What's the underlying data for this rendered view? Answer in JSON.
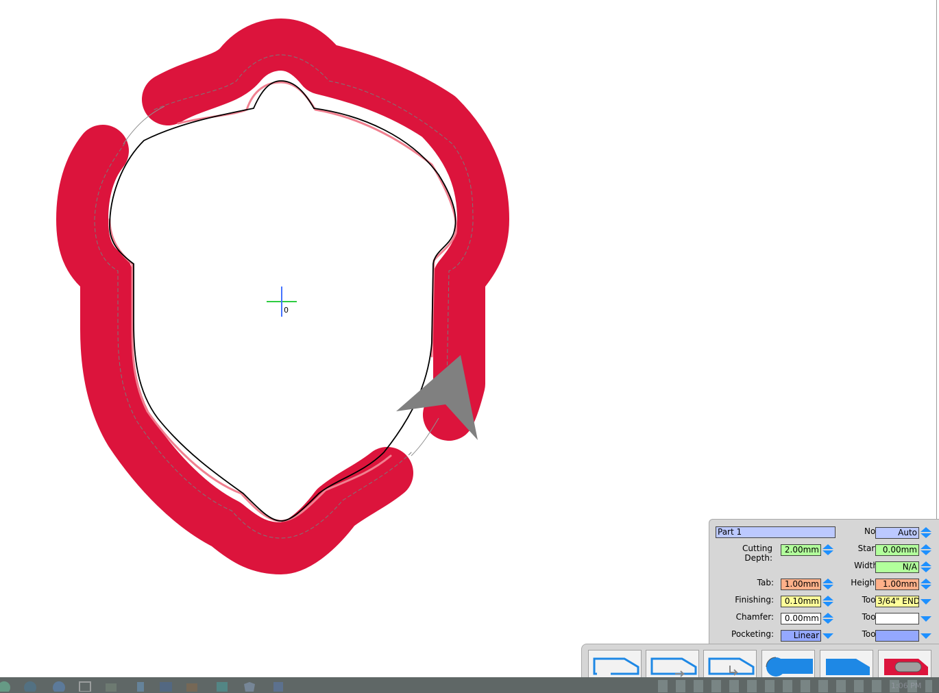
{
  "canvas": {
    "origin_label": "0",
    "colors": {
      "cut_path": "#dc143c",
      "highlight": "#f08090",
      "origin_h": "#2ecc40",
      "origin_v": "#4472ff",
      "direction_arrow": "#808080"
    }
  },
  "panel": {
    "part_name": "Part 1",
    "no_label": "No.:",
    "no_value": "Auto",
    "cutting_depth_label": "Cutting Depth:",
    "cutting_depth_value": "2.00mm",
    "start_label": "Start:",
    "start_value": "0.00mm",
    "width_label": "Width:",
    "width_value": "N/A",
    "tab_label": "Tab:",
    "tab_value": "1.00mm",
    "height_label": "Height:",
    "height_value": "1.00mm",
    "finishing_label": "Finishing:",
    "finishing_value": "0.10mm",
    "tool1_label": "Tool:",
    "tool1_value": "3/64\" END",
    "chamfer_label": "Chamfer:",
    "chamfer_value": "0.00mm",
    "tool2_label": "Tool:",
    "tool2_value": "",
    "pocketing_label": "Pocketing:",
    "pocketing_value": "Linear",
    "tool3_label": "Tool:",
    "tool3_value": ""
  },
  "tools": [
    {
      "icon": "outline-open-icon"
    },
    {
      "icon": "outline-outside-icon"
    },
    {
      "icon": "outline-inside-icon"
    },
    {
      "icon": "pocket-blue-icon"
    },
    {
      "icon": "pocket-full-icon"
    },
    {
      "icon": "red-pocket-icon"
    }
  ],
  "taskbar": {
    "icons": [
      "menu-icon",
      "steam-icon",
      "browser-icon",
      "dock-icon",
      "sheets-icon",
      "files-icon",
      "monitor-icon",
      "camera-icon",
      "app-icon",
      "shield-icon",
      "document-icon"
    ],
    "clock": "1:06 PM"
  }
}
